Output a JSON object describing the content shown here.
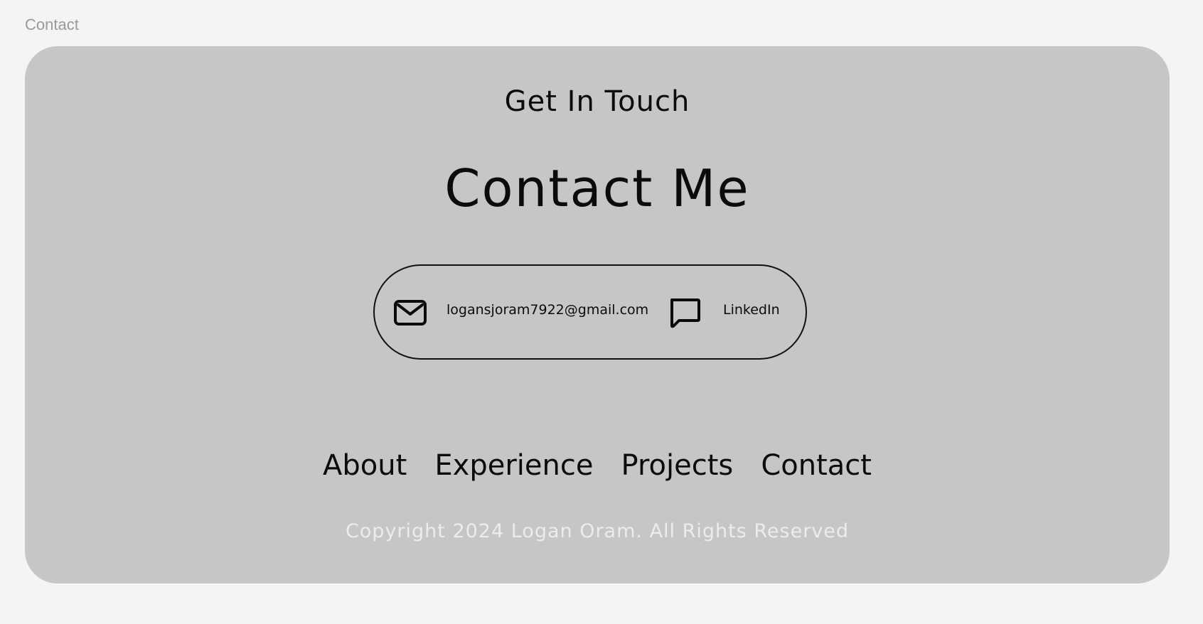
{
  "frame_label": "Contact",
  "contact": {
    "subtitle": "Get In Touch",
    "title": "Contact Me",
    "email": "logansjoram7922@gmail.com",
    "linkedin_label": "LinkedIn",
    "email_icon": "mail-icon",
    "linkedin_icon": "chat-bubble-icon"
  },
  "footer": {
    "nav": [
      "About",
      "Experience",
      "Projects",
      "Contact"
    ],
    "copyright": "Copyright 2024 Logan Oram. All Rights Reserved"
  },
  "colors": {
    "page_background": "#f4f4f4",
    "card_background": "#c6c6c6",
    "text": "#0b0b0b",
    "copyright_text": "#ececec"
  }
}
